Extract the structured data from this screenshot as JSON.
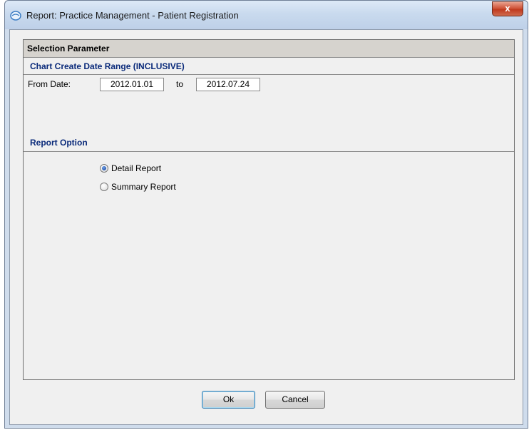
{
  "window": {
    "title": "Report: Practice Management - Patient Registration",
    "close_label": "x"
  },
  "panel": {
    "header": "Selection Parameter",
    "date_section": {
      "title": "Chart Create Date Range (INCLUSIVE)",
      "from_label": "From Date:",
      "from_value": "2012.01.01",
      "to_label": "to",
      "to_value": "2012.07.24"
    },
    "report_section": {
      "title": "Report Option",
      "options": [
        {
          "label": "Detail Report",
          "selected": true
        },
        {
          "label": "Summary Report",
          "selected": false
        }
      ]
    }
  },
  "buttons": {
    "ok": "Ok",
    "cancel": "Cancel"
  }
}
